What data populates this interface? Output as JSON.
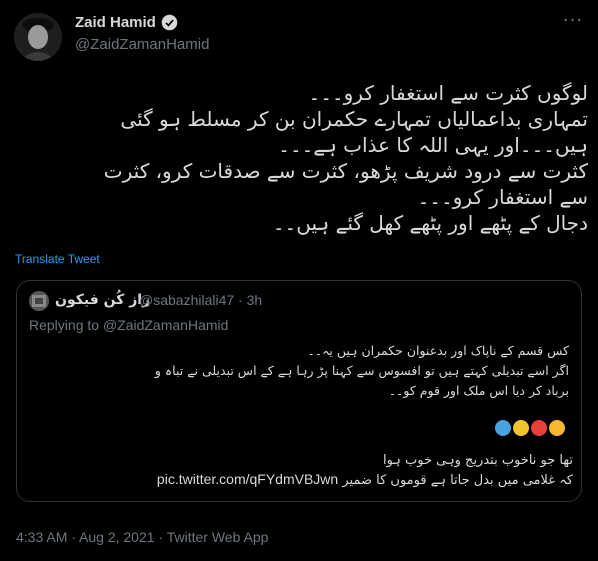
{
  "author": {
    "name": "Zaid Hamid",
    "handle": "@ZaidZamanHamid",
    "verified": true
  },
  "tweet": {
    "lines": [
      "لوگوں کثرت سے استغفار کرو۔۔۔",
      "تمہاری بداعمالیاں تمہارے حکمران بن کر مسلط ہو گئی",
      "ہیں۔۔۔اور یہی اللہ کا عذاب ہے۔۔۔",
      "کثرت سے درود شریف پڑھو، کثرت سے صدقات کرو، کثرت",
      "سے استغفار کرو۔۔۔",
      "دجال کے پٹھے اور پٹھے کھل گئے ہیں۔۔"
    ],
    "translate_label": "Translate Tweet",
    "timestamp": "4:33 AM · Aug 2, 2021 · Twitter Web App"
  },
  "quoted": {
    "name": "راز کُن فیکون",
    "handle_time": "@sabazhilali47 · 3h",
    "replying_prefix": "Replying to",
    "replying_to": "@ZaidZamanHamid",
    "lines": [
      "کس قسم کے ناپاک اور بدعنوان حکمران ہیں یہ۔۔",
      "اگر اسے تبدیلی کہتے ہیں تو افسوس سے کہنا پڑ رہا ہے کے اس تبدیلی نے تباہ و",
      "برباد کر دیا اس ملک اور قوم کو۔۔"
    ],
    "poem_line_1": "تھا جو ناخوب بتدریج وہی خوب ہوا",
    "poem_line_2_text": "کہ غلامی میں بدل جاتا ہے قوموں کا ضمیر",
    "link": "pic.twitter.com/qFYdmVBJwn",
    "emoji_colors": [
      "#f4c430",
      "#e8413c",
      "#f7b731",
      "#4aa3df"
    ]
  },
  "colors": {
    "background": "#000000",
    "text": "#d9d9d9",
    "muted": "#6e767d",
    "link": "#1da1f2",
    "border": "#2f3336",
    "verified": "#1d9bf0"
  }
}
